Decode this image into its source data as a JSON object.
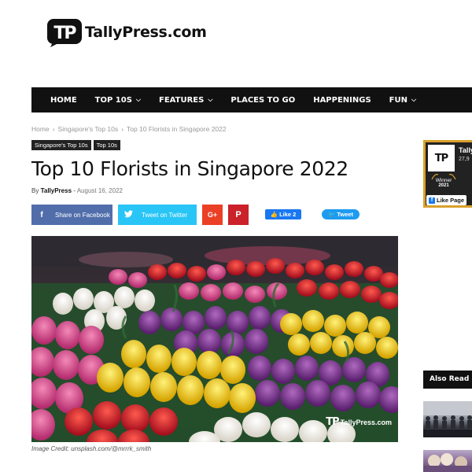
{
  "site": {
    "logo_mark": "TP",
    "name": "TallyPress.com"
  },
  "nav": {
    "items": [
      {
        "label": "HOME",
        "has_dropdown": false
      },
      {
        "label": "TOP 10S",
        "has_dropdown": true
      },
      {
        "label": "FEATURES",
        "has_dropdown": true
      },
      {
        "label": "PLACES TO GO",
        "has_dropdown": false
      },
      {
        "label": "HAPPENINGS",
        "has_dropdown": false
      },
      {
        "label": "FUN",
        "has_dropdown": true
      }
    ],
    "dropdown_icon": "chevron-down-icon"
  },
  "breadcrumb": {
    "items": [
      "Home",
      "Singapore's Top 10s",
      "Top 10 Florists in Singapore 2022"
    ],
    "separator": "›"
  },
  "article": {
    "tags": [
      "Singapore's Top 10s",
      "Top 10s"
    ],
    "title": "Top 10 Florists in Singapore 2022",
    "byline_prefix": "By",
    "author": "TallyPress",
    "byline_dash": "-",
    "date": "August 16, 2022",
    "image_credit": "Image Credit: unsplash.com/@mrrrk_smith",
    "watermark_mark": "TP",
    "watermark_text": "TallyPress.com"
  },
  "share": {
    "facebook": {
      "icon": "f",
      "label": "Share on Facebook",
      "color": "#516eab"
    },
    "twitter": {
      "icon": "🐦",
      "label": "Tweet on Twitter",
      "color": "#29c5f6"
    },
    "google_plus": {
      "label": "G+",
      "color": "#eb4026"
    },
    "pinterest": {
      "label": "P",
      "color": "#ca212a"
    },
    "like_button": "👍 Like 2",
    "tweet_button": "🐦 Tweet"
  },
  "sidebar": {
    "fb_widget": {
      "page_name": "Tally",
      "followers": "27,9",
      "badge_label": "Winner",
      "badge_year": "2021",
      "like_page": "Like Page",
      "avatar_mark": "TP"
    },
    "also_read_label": "Also Read"
  },
  "colors": {
    "nav_bg": "#111111",
    "accent_gold": "#d9a02a"
  }
}
